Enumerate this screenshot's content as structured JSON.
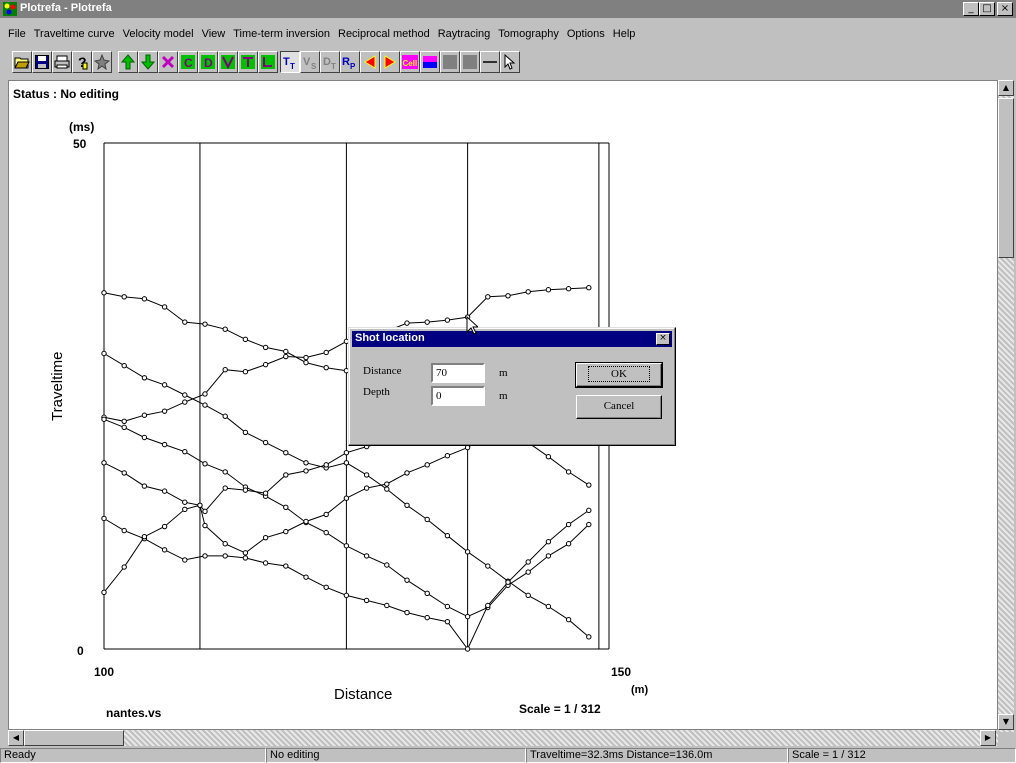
{
  "window": {
    "title": "Plotrefa - Plotrefa",
    "minimize": "_",
    "maximize": "□",
    "close": "×"
  },
  "menu": [
    "File",
    "Traveltime curve",
    "Velocity model",
    "View",
    "Time-term inversion",
    "Reciprocal method",
    "Raytracing",
    "Tomography",
    "Options",
    "Help"
  ],
  "toolbar": {
    "buttons": [
      {
        "icon": "open-folder-icon"
      },
      {
        "icon": "save-disk-icon"
      },
      {
        "icon": "print-icon"
      },
      {
        "icon": "help-question-icon"
      },
      {
        "icon": "pin-icon"
      },
      {
        "icon": "arrow-up-icon",
        "color": "#00a000"
      },
      {
        "icon": "arrow-down-icon",
        "color": "#00a000"
      },
      {
        "icon": "delete-x-icon",
        "color": "#a000a0"
      },
      {
        "icon": "c-icon",
        "label": "C"
      },
      {
        "icon": "d-icon",
        "label": "D"
      },
      {
        "icon": "v-shape-icon"
      },
      {
        "icon": "t-shape-icon"
      },
      {
        "icon": "l-shape-icon"
      },
      {
        "icon": "tt-icon",
        "label": "T",
        "sub": "T"
      },
      {
        "icon": "vs-icon",
        "label": "V",
        "sub": "S"
      },
      {
        "icon": "dt-icon",
        "label": "D",
        "sub": "T"
      },
      {
        "icon": "rp-icon",
        "label": "R",
        "sub": "P"
      },
      {
        "icon": "arrow-left-icon"
      },
      {
        "icon": "arrow-right-icon"
      },
      {
        "icon": "cell-icon",
        "label": "Cell"
      },
      {
        "icon": "color-bar-icon"
      },
      {
        "icon": "gray-box-icon"
      },
      {
        "icon": "gray-box-2-icon"
      },
      {
        "icon": "line-icon"
      },
      {
        "icon": "pointer-icon"
      }
    ]
  },
  "status_label": "Status : No editing",
  "chart_data": {
    "type": "line",
    "title": "",
    "xlabel": "Distance",
    "ylabel": "Traveltime",
    "x_unit": "(m)",
    "y_unit": "(ms)",
    "xlim": [
      100,
      150
    ],
    "ylim": [
      0,
      50
    ],
    "x_ticks": [
      "100",
      "150"
    ],
    "y_ticks": [
      "50",
      "0"
    ],
    "grid": false,
    "shot_positions": [
      109.5,
      124,
      136,
      149
    ],
    "series": [
      {
        "x": [
          100,
          102,
          104,
          106,
          108,
          110,
          112,
          114,
          116,
          118,
          120,
          122,
          124,
          126,
          128,
          130,
          132,
          134,
          136,
          138,
          140,
          142,
          144,
          146,
          148
        ],
        "y": [
          35.2,
          34.8,
          34.6,
          33.8,
          32.3,
          32.1,
          31.6,
          30.6,
          29.8,
          29.4,
          28.3,
          27.8,
          27.5,
          26.8,
          26.4,
          26.2,
          25.0,
          24.2,
          23.5,
          23.0,
          21.4,
          20.4,
          19.0,
          17.5,
          16.2
        ]
      },
      {
        "x": [
          100,
          102,
          104,
          106,
          108,
          110,
          112,
          114,
          116,
          118,
          120,
          122,
          124,
          126,
          128,
          130,
          132,
          134,
          136,
          138,
          140,
          142,
          144,
          146,
          148
        ],
        "y": [
          22.9,
          22.5,
          23.1,
          23.5,
          24.4,
          25.2,
          27.6,
          27.4,
          28.1,
          28.9,
          28.8,
          29.3,
          30.4,
          31.3,
          31.4,
          32.2,
          32.3,
          32.5,
          32.8,
          34.8,
          34.9,
          35.3,
          35.5,
          35.6,
          35.7
        ]
      },
      {
        "x": [
          100,
          102,
          104,
          106,
          108,
          110,
          112,
          114,
          116,
          118,
          120,
          122,
          124,
          126,
          128,
          130,
          132,
          134,
          136,
          138,
          140,
          142,
          144,
          146,
          148
        ],
        "y": [
          29.2,
          28.0,
          26.8,
          26.1,
          25.1,
          24.1,
          23.0,
          21.4,
          20.4,
          19.4,
          18.4,
          17.9,
          18.4,
          17.2,
          15.8,
          14.2,
          12.8,
          11.2,
          9.6,
          8.2,
          6.7,
          5.3,
          4.2,
          2.9,
          1.2
        ]
      },
      {
        "x": [
          100,
          102,
          104,
          106,
          108,
          110,
          112,
          114,
          116,
          118,
          120,
          122,
          124,
          126,
          128,
          130,
          132,
          134,
          136,
          138,
          140,
          142,
          144,
          146,
          148
        ],
        "y": [
          22.7,
          21.9,
          20.9,
          20.2,
          19.5,
          18.3,
          17.5,
          16.0,
          15.1,
          14.0,
          12.5,
          11.5,
          10.2,
          9.2,
          8.3,
          6.8,
          5.5,
          4.2,
          3.2,
          4.1,
          6.3,
          7.6,
          9.2,
          10.4,
          12.3
        ]
      },
      {
        "x": [
          100,
          102,
          104,
          106,
          108,
          109.5,
          110,
          112,
          114,
          116,
          118,
          120,
          122,
          124,
          126,
          128,
          130,
          132,
          134,
          136,
          138,
          140,
          142,
          144,
          146,
          148
        ],
        "y": [
          18.4,
          17.4,
          16.1,
          15.6,
          14.5,
          14.2,
          13.6,
          15.9,
          15.7,
          15.4,
          17.2,
          17.6,
          18.2,
          19.4,
          20.0,
          20.5,
          20.8,
          21.9,
          22.7,
          23.2,
          24.9,
          26.9,
          27.6,
          29.1,
          30.7,
          31.1
        ]
      },
      {
        "x": [
          100,
          102,
          104,
          106,
          108,
          110,
          112,
          114,
          116,
          118,
          120,
          122,
          124,
          126,
          128,
          130,
          132,
          134,
          136,
          138,
          140,
          142,
          144,
          146,
          148
        ],
        "y": [
          12.9,
          11.7,
          10.9,
          9.8,
          8.8,
          9.2,
          9.2,
          9.0,
          8.5,
          8.2,
          7.1,
          6.1,
          5.3,
          4.8,
          4.3,
          3.6,
          3.1,
          2.7,
          0.0,
          4.3,
          6.6,
          8.6,
          10.6,
          12.3,
          13.7
        ]
      },
      {
        "x": [
          100,
          102,
          104,
          106,
          108,
          109.5,
          110,
          112,
          114,
          116,
          118,
          120,
          122,
          124,
          126,
          128,
          130,
          132,
          134,
          136,
          138,
          140,
          142,
          144,
          146,
          148
        ],
        "y": [
          5.6,
          8.1,
          11.1,
          12.1,
          13.8,
          14.2,
          12.2,
          10.4,
          9.5,
          11.0,
          11.6,
          12.6,
          13.3,
          14.9,
          15.9,
          16.3,
          17.4,
          18.2,
          19.1,
          19.9,
          21.2,
          22.4,
          24.0,
          25.1,
          26.6,
          28.1
        ]
      }
    ]
  },
  "dialog": {
    "title": "Shot location",
    "close": "×",
    "distance_label": "Distance",
    "distance_value": "70",
    "depth_label": "Depth",
    "depth_value": "0",
    "unit": "m",
    "ok_label": "OK",
    "cancel_label": "Cancel"
  },
  "file_label": "nantes.vs",
  "scale_label": "Scale = 1 / 312",
  "statusbar": {
    "ready": "Ready",
    "mode": "No editing",
    "readout": "Traveltime=32.3ms  Distance=136.0m",
    "scale": "Scale = 1 / 312"
  },
  "colors": {
    "title_inactive": "#808080",
    "dialog_title": "#000080",
    "face": "#c0c0c0"
  }
}
